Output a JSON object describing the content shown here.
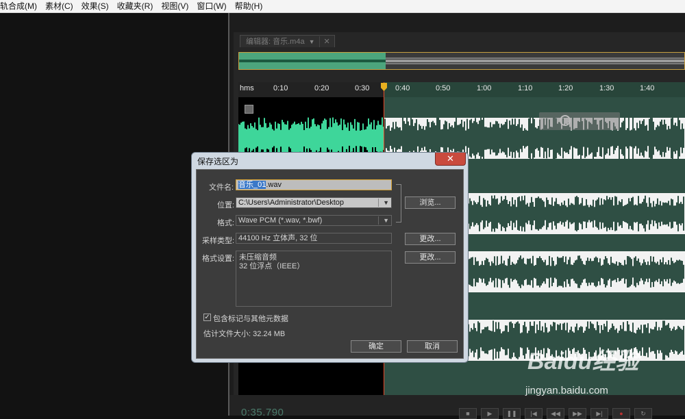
{
  "menu": [
    "轨合成(M)",
    "素材(C)",
    "效果(S)",
    "收藏夹(R)",
    "视图(V)",
    "窗口(W)",
    "帮助(H)"
  ],
  "editor": {
    "tab_label": "编辑器: 音乐.m4a",
    "ruler_unit": "hms",
    "ruler_ticks": [
      "0:10",
      "0:20",
      "0:30",
      "0:40",
      "0:50",
      "1:00",
      "1:10",
      "1:20",
      "1:30",
      "1:40"
    ],
    "time_display": "0:35.790"
  },
  "dialog": {
    "title": "保存选区为",
    "filename_label": "文件名:",
    "filename_selected": "音乐_01",
    "filename_rest": ".wav",
    "location_label": "位置:",
    "location_value": "C:\\Users\\Administrator\\Desktop",
    "format_label": "格式:",
    "format_value": "Wave PCM (*.wav, *.bwf)",
    "sample_type_label": "采样类型:",
    "sample_type_value": "44100 Hz 立体声, 32 位",
    "format_settings_label": "格式设置:",
    "format_settings_line1": "未压缩音频",
    "format_settings_line2": "32 位浮点（IEEE）",
    "browse_button": "浏览...",
    "change_button_1": "更改...",
    "change_button_2": "更改...",
    "include_markers_label": "包含标记与其他元数据",
    "estimated_size": "估计文件大小: 32.24 MB",
    "ok_button": "确定",
    "cancel_button": "取消"
  },
  "watermark": {
    "main": "Baidu经验",
    "sub": "jingyan.baidu.com"
  },
  "colors": {
    "selection_wave": "#3ed69a",
    "unselected_bg": "#2f4f44",
    "playhead": "#e84a2a",
    "selection_highlight": "#3a78c8"
  }
}
